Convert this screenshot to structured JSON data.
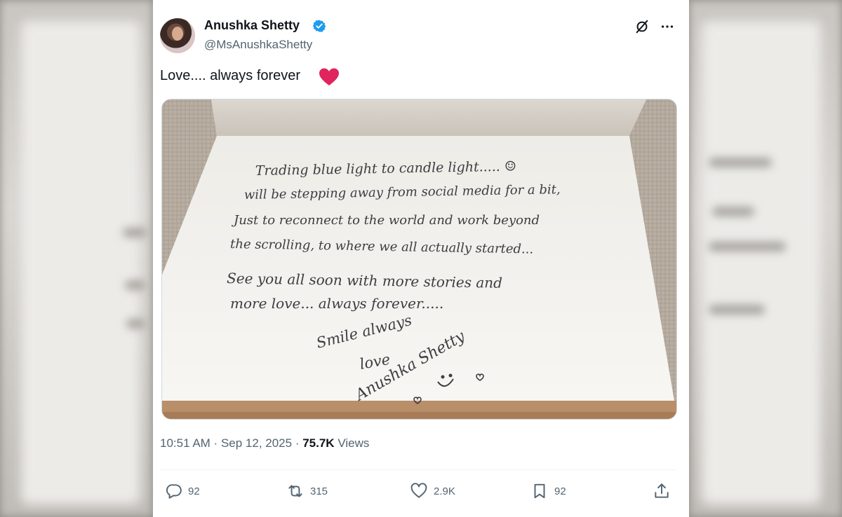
{
  "author": {
    "name": "Anushka Shetty",
    "handle": "@MsAnushkaShetty"
  },
  "tweet": {
    "text": "Love.... always forever"
  },
  "note": {
    "line1": "Trading blue light to candle light..... ☺",
    "line2": "will be stepping away from social media for a bit,",
    "line3": "Just to reconnect to the world and work beyond",
    "line4": "the scrolling, to where we all actually started...",
    "line5": "See you all soon with more stories and",
    "line6": "more love... always forever.....",
    "signoff1": "Smile always",
    "signoff2": "love",
    "signature": "Anushka Shetty"
  },
  "meta": {
    "time": "10:51 AM",
    "separator": " · ",
    "date": "Sep 12, 2025",
    "views_count": "75.7K",
    "views_label": "Views"
  },
  "actions": {
    "replies": "92",
    "reposts": "315",
    "likes": "2.9K",
    "bookmarks": "92"
  },
  "colors": {
    "verified": "#1d9bf0",
    "heart": "#e0245e",
    "text": "#0f1419",
    "secondary": "#536471"
  }
}
